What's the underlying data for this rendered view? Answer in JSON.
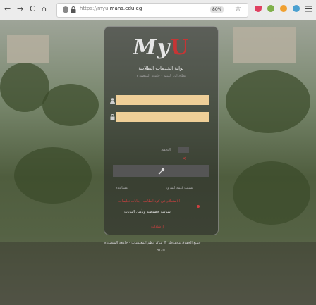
{
  "browser": {
    "back_glyph": "←",
    "forward_glyph": "→",
    "reload_glyph": "C",
    "home_glyph": "⌂",
    "url": "https://myu.mans.edu.eg",
    "url_prefix": "https://myu.",
    "url_domain": "mans.edu.eg",
    "zoom": "80%",
    "star_glyph": "☆"
  },
  "login": {
    "logo_text": "My",
    "logo_u": "U",
    "title": "بوابة الخدمات الطلابية",
    "subtitle": "نظام ابن الهيثم - جامعة المنصورة",
    "username_value": "",
    "password_value": "",
    "captcha_label": "التحقق",
    "captcha_x": "×",
    "login_icon": "🔑",
    "forgot_password": "نسيت كلمة المرور",
    "help": "مساعدة",
    "register_warning": "الاستعلام عن كود الطالب - بيانات تعليمات",
    "privacy_policy": "سياسة خصوصية وتأمين البيانات",
    "guide": "إرشادات"
  },
  "footer": {
    "copyright": "جميع الحقوق محفوظة © مركز نظم المعلومات - جامعة المنصورة",
    "year": "2020"
  },
  "colors": {
    "field_bg": "#efcf98",
    "accent_red": "#d04040"
  }
}
